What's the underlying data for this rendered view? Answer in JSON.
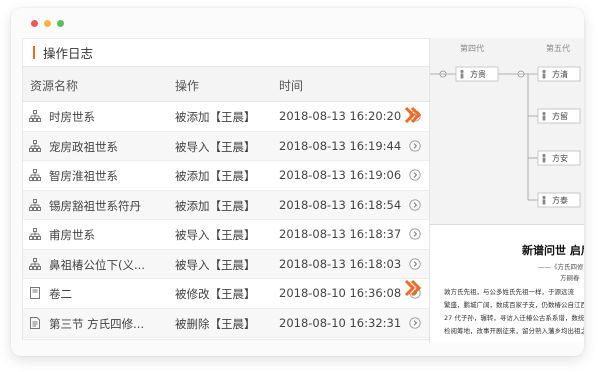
{
  "window": {
    "controls": [
      "close",
      "minimize",
      "zoom"
    ],
    "colors": {
      "close": "#f25656",
      "minimize": "#f5b63c",
      "zoom": "#55c15a"
    }
  },
  "log": {
    "title": "操作日志",
    "accent_color": "#f26a21",
    "columns": {
      "name": "资源名称",
      "action": "操作",
      "time": "时间"
    },
    "rows": [
      {
        "icon": "tree-icon",
        "name": "时房世系",
        "action": "被添加【王晨】",
        "time": "2018-08-13 16:20:20"
      },
      {
        "icon": "tree-icon",
        "name": "宠房政祖世系",
        "action": "被导入【王晨】",
        "time": "2018-08-13 16:19:44"
      },
      {
        "icon": "tree-icon",
        "name": "智房淮祖世系",
        "action": "被添加【王晨】",
        "time": "2018-08-13 16:19:06"
      },
      {
        "icon": "tree-icon",
        "name": "锡房豁祖世系符丹",
        "action": "被添加【王晨】",
        "time": "2018-08-13 16:18:54"
      },
      {
        "icon": "tree-icon",
        "name": "甫房世系",
        "action": "被导入【王晨】",
        "time": "2018-08-13 16:18:37"
      },
      {
        "icon": "tree-icon",
        "name": "鼻祖椿公位下(义...",
        "action": "被导入【王晨】",
        "time": "2018-08-13 16:18:03"
      },
      {
        "icon": "book-icon",
        "name": "卷二",
        "action": "被修改【王晨】",
        "time": "2018-08-10 16:36:08"
      },
      {
        "icon": "document-icon",
        "name": "第三节 方氏四修...",
        "action": "被删除【王晨】",
        "time": "2018-08-10 16:32:31"
      }
    ]
  },
  "tree": {
    "generations": [
      "第四代",
      "第五代"
    ],
    "parent": "方贵",
    "children": [
      "方清",
      "方留",
      "方安",
      "方泰"
    ]
  },
  "book": {
    "heading": "新谱问世  启后",
    "subtitle": "——《方氏四修族谱",
    "author": "方嗣春",
    "lines": [
      "敦方氏先祖，与公多姓氏先祖一样，于源远流",
      "繁盛，鹏城广阔，数成百家子支，仍数椿公自江西",
      "27 代子孙，辗转，寻访入迁椿公古系系谱，数统",
      "检阅筹地，改事开剧征来，留分熟入藩乡均出祖之"
    ]
  }
}
